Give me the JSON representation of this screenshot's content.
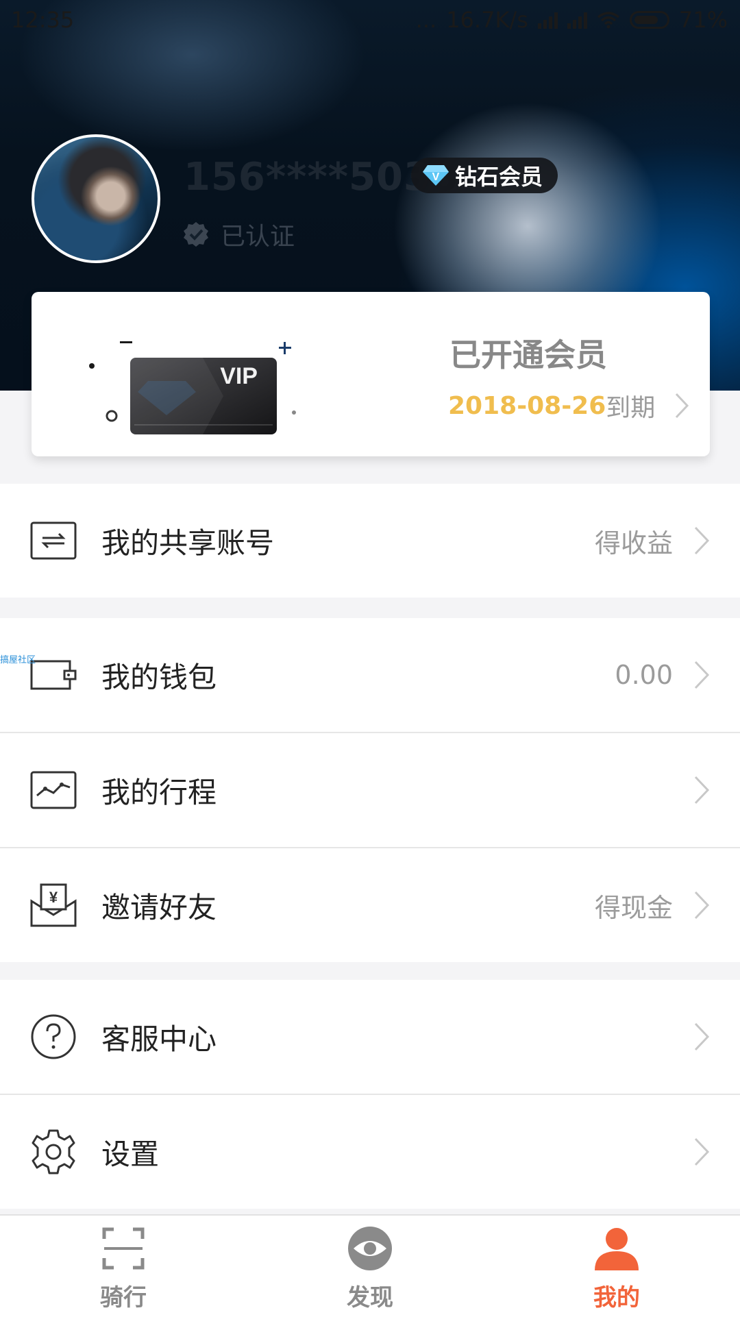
{
  "status_bar": {
    "time": "12:35",
    "network_speed": "16.7K/s",
    "battery_percent": "71%",
    "dots": "..."
  },
  "profile": {
    "phone": "156****5038",
    "member_badge": "钻石会员",
    "badge_letter": "V",
    "verified_text": "已认证"
  },
  "vip_card": {
    "card_label": "VIP",
    "title": "已开通会员",
    "expire_date": "2018-08-26",
    "expire_suffix": "到期"
  },
  "menu": {
    "shared_account": {
      "label": "我的共享账号",
      "value": "得收益"
    },
    "wallet": {
      "label": "我的钱包",
      "value": "0.00"
    },
    "trips": {
      "label": "我的行程",
      "value": ""
    },
    "invite": {
      "label": "邀请好友",
      "value": "得现金"
    },
    "support": {
      "label": "客服中心",
      "value": ""
    },
    "settings": {
      "label": "设置",
      "value": ""
    }
  },
  "watermark": "搞屋社区",
  "tabs": [
    {
      "label": "骑行",
      "icon": "scan-icon"
    },
    {
      "label": "发现",
      "icon": "eye-icon"
    },
    {
      "label": "我的",
      "icon": "person-icon"
    }
  ],
  "colors": {
    "accent": "#f2643a",
    "date": "#f0bd4e",
    "header_blue": "#0056a0"
  }
}
